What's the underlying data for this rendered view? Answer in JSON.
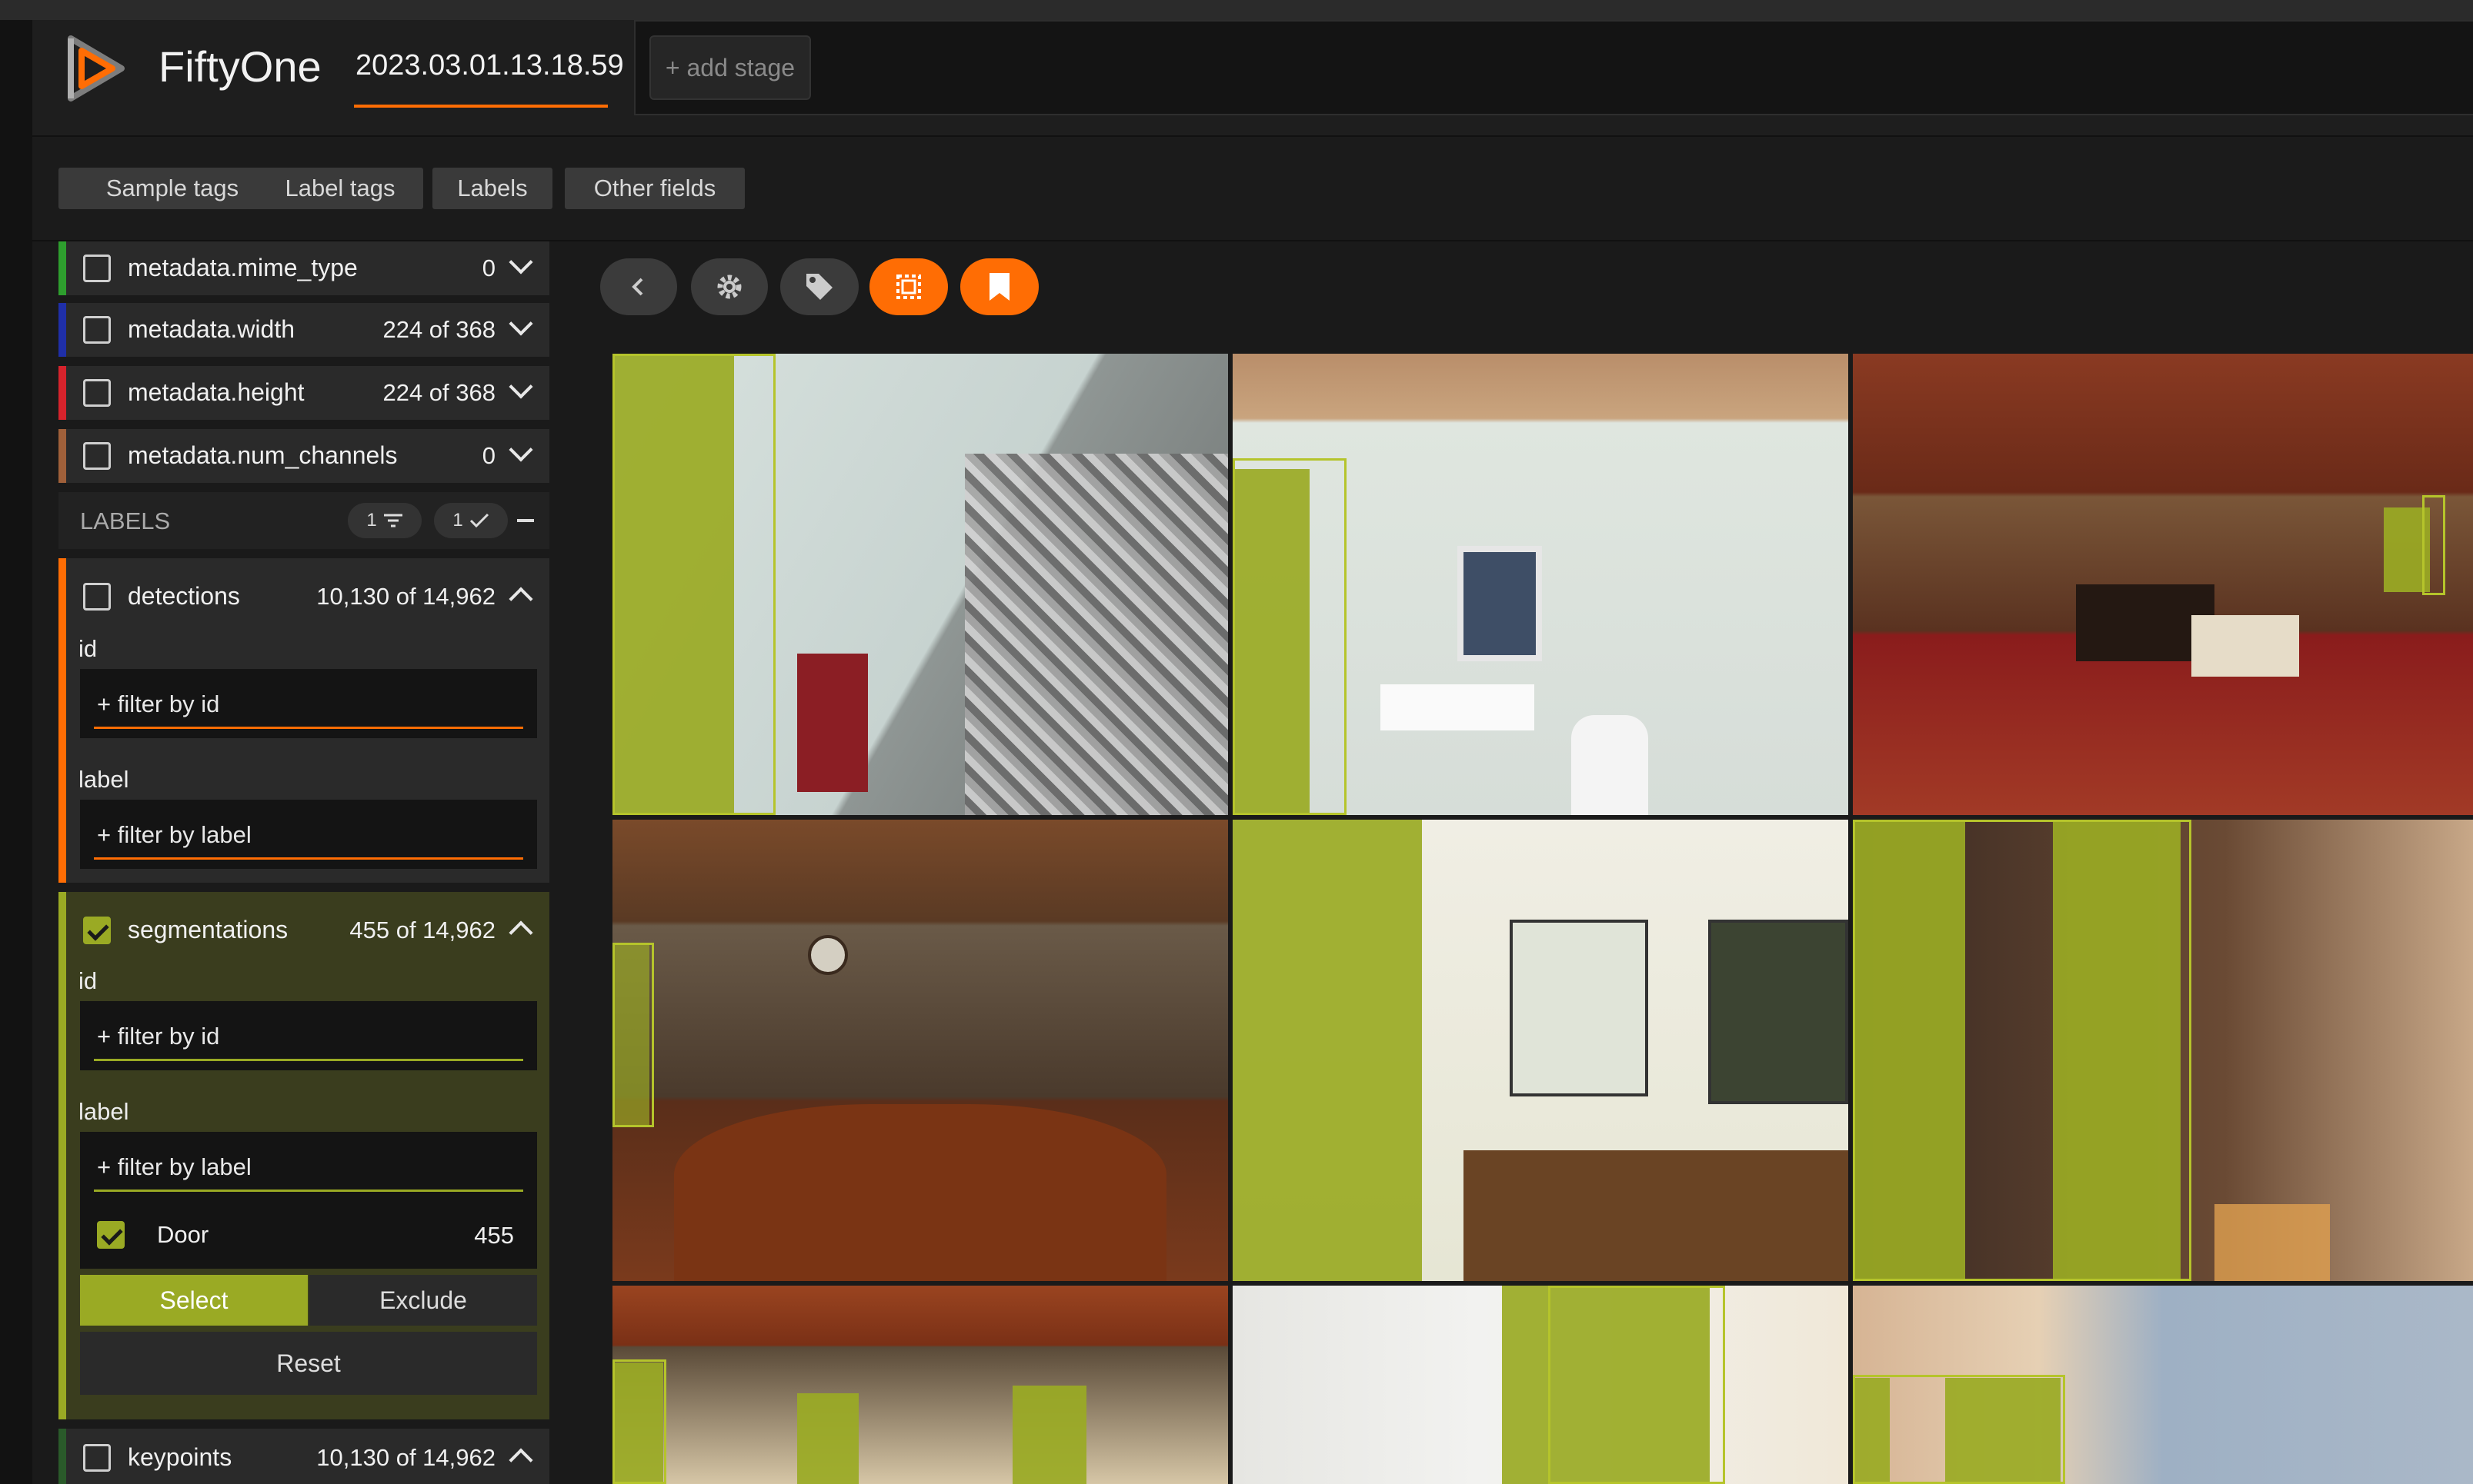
{
  "header": {
    "app_name": "FiftyOne",
    "dataset_name": "2023.03.01.13.18.59",
    "add_stage_label": "+ add stage"
  },
  "tabs": [
    "Sample tags",
    "Label tags",
    "Labels",
    "Other fields"
  ],
  "sidebar": {
    "metadata_fields": [
      {
        "name": "metadata.mime_type",
        "count": "0",
        "color": "#2e9e2e"
      },
      {
        "name": "metadata.width",
        "count": "224 of 368",
        "color": "#1f2fa8"
      },
      {
        "name": "metadata.height",
        "count": "224 of 368",
        "color": "#d6232c"
      },
      {
        "name": "metadata.num_channels",
        "count": "0",
        "color": "#a0603a"
      }
    ],
    "labels_group": {
      "title": "LABELS",
      "filter_badge": "1",
      "visible_badge": "1"
    },
    "detections": {
      "name": "detections",
      "count": "10,130 of 14,962",
      "color": "#ff6d04",
      "id_label": "id",
      "id_placeholder": "+ filter by id",
      "label_label": "label",
      "label_placeholder": "+ filter by label"
    },
    "segmentations": {
      "name": "segmentations",
      "count": "455 of 14,962",
      "color": "#9aaa24",
      "id_label": "id",
      "id_placeholder": "+ filter by id",
      "label_label": "label",
      "label_placeholder": "+ filter by label",
      "value": {
        "name": "Door",
        "count": "455"
      },
      "select_label": "Select",
      "exclude_label": "Exclude",
      "reset_label": "Reset"
    },
    "keypoints": {
      "name": "keypoints",
      "count": "10,130 of 14,962",
      "color": "#2a5a2a"
    }
  },
  "toolbar": {
    "icons": [
      "chevron-left-icon",
      "gear-icon",
      "tag-icon",
      "select-box-icon",
      "bookmark-icon"
    ],
    "accent": "#ff6d04"
  },
  "colors": {
    "accent": "#ff6d04",
    "segmentation": "#9aaa24",
    "background": "#1a1a1a"
  }
}
